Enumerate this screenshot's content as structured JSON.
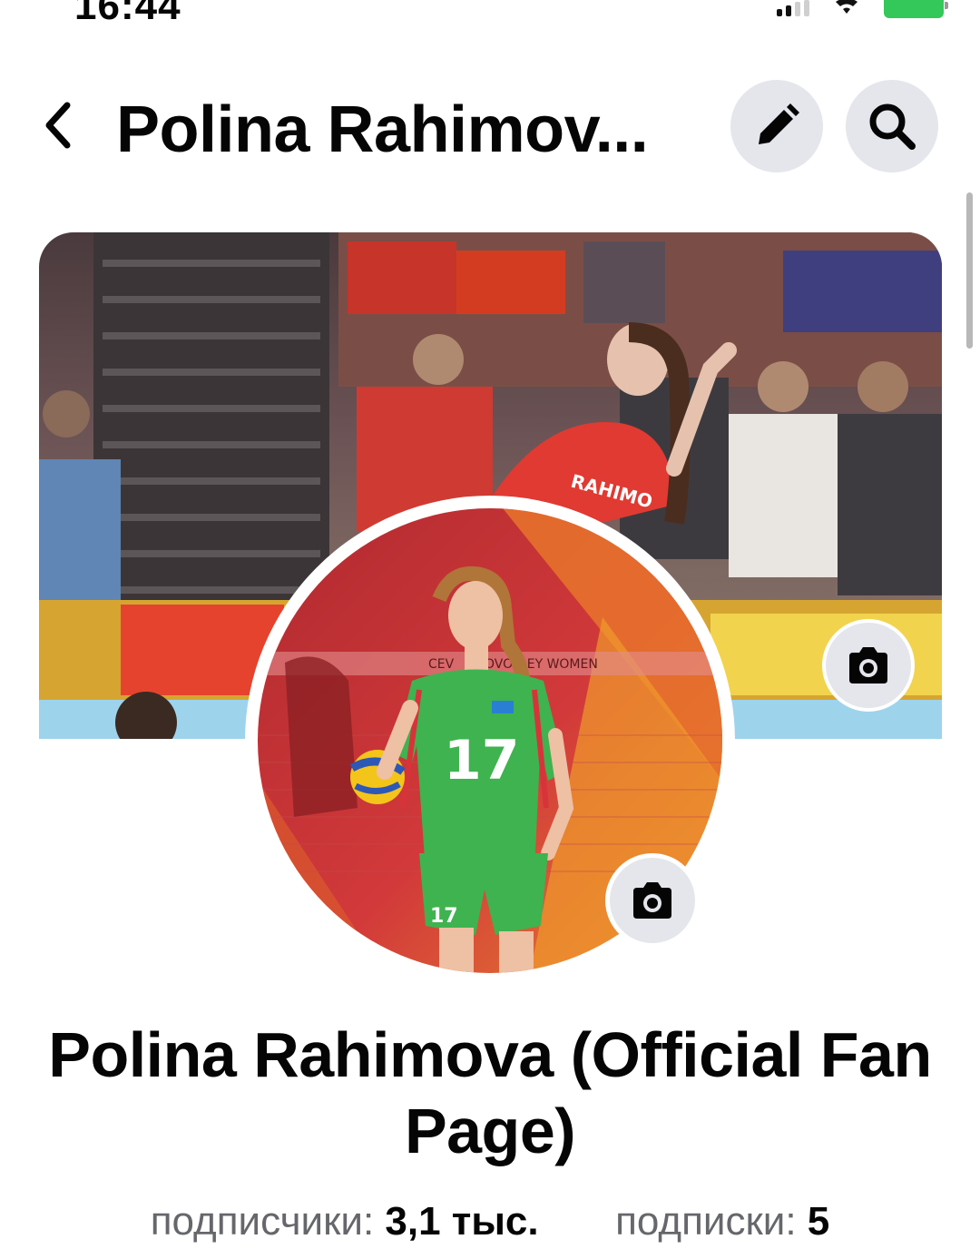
{
  "status_bar": {
    "time": "16:44",
    "icons": [
      "cellular-signal-icon",
      "wifi-icon",
      "battery-charging-icon"
    ]
  },
  "header": {
    "back_icon": "chevron-left-icon",
    "title": "Polina Rahimov...",
    "edit_icon": "pencil-icon",
    "search_icon": "search-icon"
  },
  "cover": {
    "camera_icon": "camera-icon",
    "jersey_text": "RAHIMO",
    "banner_text": "OVOLLEY WOMEN",
    "banner_text_2": "CEV"
  },
  "profile": {
    "camera_icon": "camera-icon",
    "jersey_number": "17",
    "shorts_number": "17"
  },
  "page": {
    "full_name": "Polina Rahimova (Official Fan Page)"
  },
  "stats": {
    "followers_label": "подписчики:",
    "followers_value": "3,1 тыс.",
    "following_label": "подписки:",
    "following_value": "5"
  },
  "colors": {
    "icon_button_bg": "#e4e6eb",
    "text_primary": "#050505",
    "text_secondary": "#65676b",
    "battery_green": "#34c759",
    "jersey_green": "#3fb34f",
    "overlay_red": "#d2232a",
    "overlay_orange": "#f28c28"
  }
}
